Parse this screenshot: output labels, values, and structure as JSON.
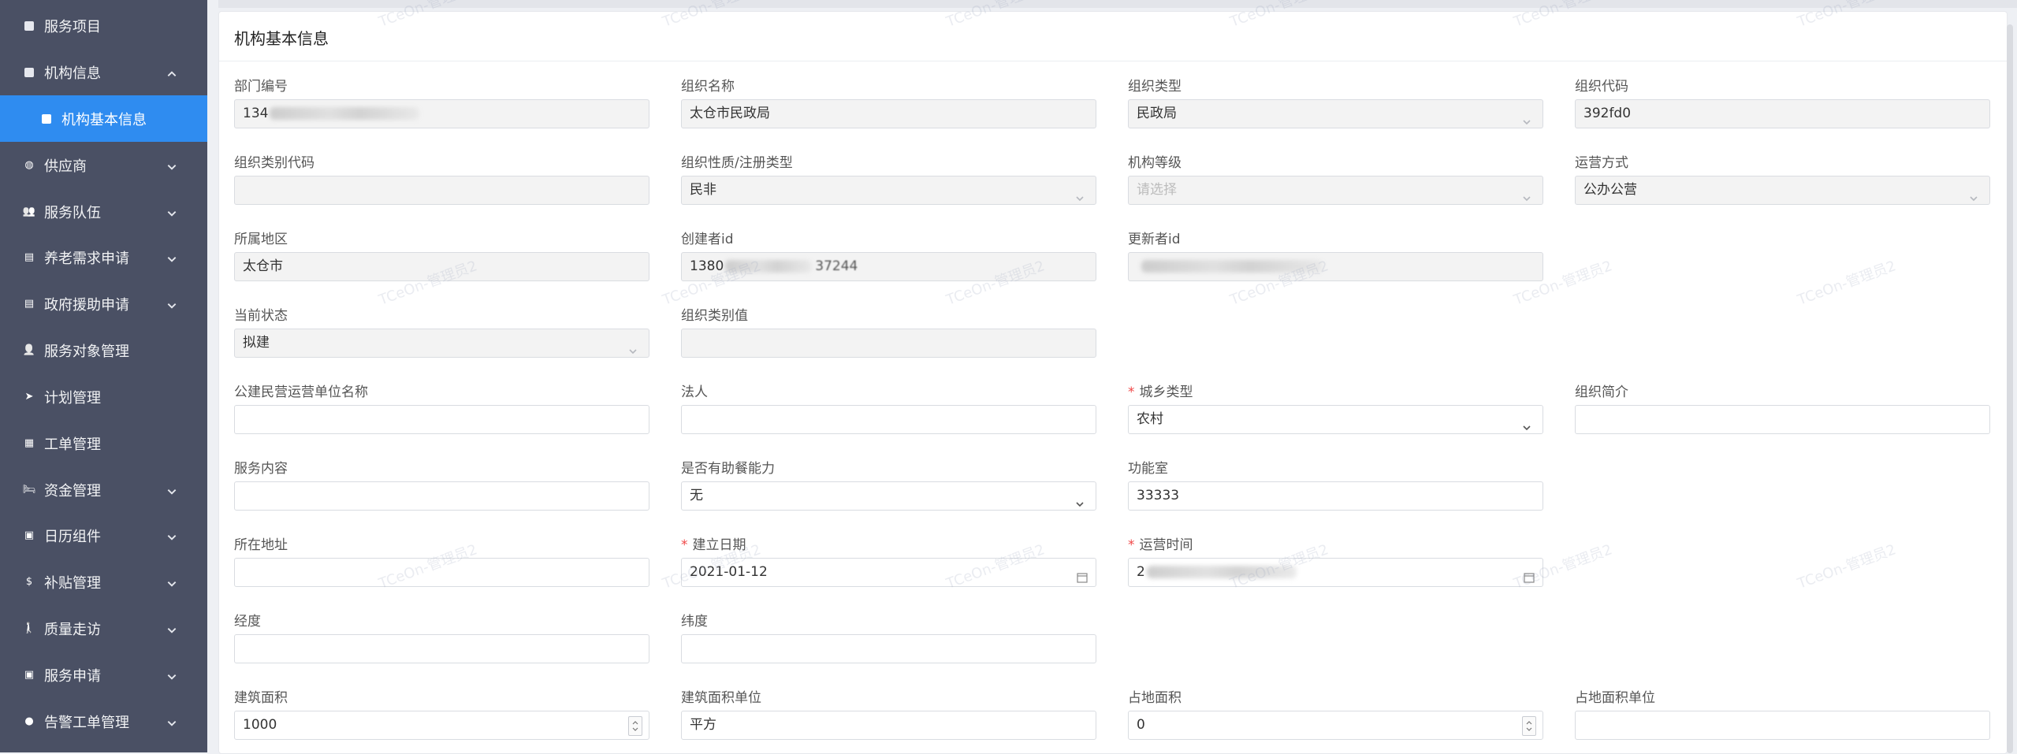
{
  "sidebar": {
    "items": [
      {
        "label": "服务项目",
        "icon": "square-icon",
        "expandable": false
      },
      {
        "label": "机构信息",
        "icon": "square-icon",
        "expandable": true,
        "expanded": true
      },
      {
        "label": "机构基本信息",
        "icon": "square-icon",
        "active": true,
        "sub": true
      },
      {
        "label": "供应商",
        "icon": "globe-icon",
        "expandable": true
      },
      {
        "label": "服务队伍",
        "icon": "team-icon",
        "expandable": true
      },
      {
        "label": "养老需求申请",
        "icon": "form-icon",
        "expandable": true
      },
      {
        "label": "政府援助申请",
        "icon": "form-icon",
        "expandable": true
      },
      {
        "label": "服务对象管理",
        "icon": "user-icon",
        "expandable": false
      },
      {
        "label": "计划管理",
        "icon": "send-icon",
        "expandable": false
      },
      {
        "label": "工单管理",
        "icon": "grid-icon",
        "expandable": false
      },
      {
        "label": "资金管理",
        "icon": "bed-icon",
        "expandable": true
      },
      {
        "label": "日历组件",
        "icon": "calendar-icon",
        "expandable": true
      },
      {
        "label": "补贴管理",
        "icon": "dollar-icon",
        "expandable": true
      },
      {
        "label": "质量走访",
        "icon": "walk-icon",
        "expandable": true
      },
      {
        "label": "服务申请",
        "icon": "calendar-icon",
        "expandable": true
      },
      {
        "label": "告警工单管理",
        "icon": "alert-icon",
        "expandable": true
      }
    ],
    "colors": {
      "bg": "#4a5064",
      "active": "#2f8cf0"
    }
  },
  "card": {
    "title": "机构基本信息"
  },
  "watermark": "TCeOn-管理员2",
  "fields": [
    {
      "label": "部门编号",
      "value": "134",
      "type": "disabled",
      "blurred": true
    },
    {
      "label": "组织名称",
      "value": "太仓市民政局",
      "type": "disabled"
    },
    {
      "label": "组织类型",
      "value": "民政局",
      "type": "select-disabled"
    },
    {
      "label": "组织代码",
      "value": "392fd0",
      "type": "disabled"
    },
    {
      "label": "组织类别代码",
      "value": "",
      "type": "disabled"
    },
    {
      "label": "组织性质/注册类型",
      "value": "民非",
      "type": "select-disabled"
    },
    {
      "label": "机构等级",
      "value": "",
      "placeholder": "请选择",
      "type": "select-disabled"
    },
    {
      "label": "运营方式",
      "value": "公办公营",
      "type": "select-disabled"
    },
    {
      "label": "所属地区",
      "value": "太仓市",
      "type": "disabled"
    },
    {
      "label": "创建者id",
      "value": "1380",
      "suffix": "37244",
      "type": "disabled",
      "blurred": true
    },
    {
      "label": "更新者id",
      "value": "",
      "type": "disabled",
      "blurred": true
    },
    null,
    {
      "label": "当前状态",
      "value": "拟建",
      "type": "select-disabled"
    },
    {
      "label": "组织类别值",
      "value": "",
      "type": "disabled"
    },
    null,
    null,
    {
      "label": "公建民营运营单位名称",
      "value": "",
      "type": "input"
    },
    {
      "label": "法人",
      "value": "",
      "type": "input"
    },
    {
      "label": "城乡类型",
      "value": "农村",
      "type": "select",
      "required": true
    },
    {
      "label": "组织简介",
      "value": "",
      "type": "input"
    },
    {
      "label": "服务内容",
      "value": "",
      "type": "input"
    },
    {
      "label": "是否有助餐能力",
      "value": "无",
      "type": "select"
    },
    {
      "label": "功能室",
      "value": "33333",
      "type": "input"
    },
    null,
    {
      "label": "所在地址",
      "value": "",
      "type": "input"
    },
    {
      "label": "建立日期",
      "value": "2021-01-12",
      "type": "date",
      "required": true
    },
    {
      "label": "运营时间",
      "value": "2",
      "type": "date",
      "required": true,
      "blurred": true
    },
    null,
    {
      "label": "经度",
      "value": "",
      "type": "input"
    },
    {
      "label": "纬度",
      "value": "",
      "type": "input"
    },
    null,
    null,
    {
      "label": "建筑面积",
      "value": "1000",
      "type": "number"
    },
    {
      "label": "建筑面积单位",
      "value": "平方",
      "type": "input"
    },
    {
      "label": "占地面积",
      "value": "0",
      "type": "number"
    },
    {
      "label": "占地面积单位",
      "value": "",
      "type": "input"
    }
  ]
}
